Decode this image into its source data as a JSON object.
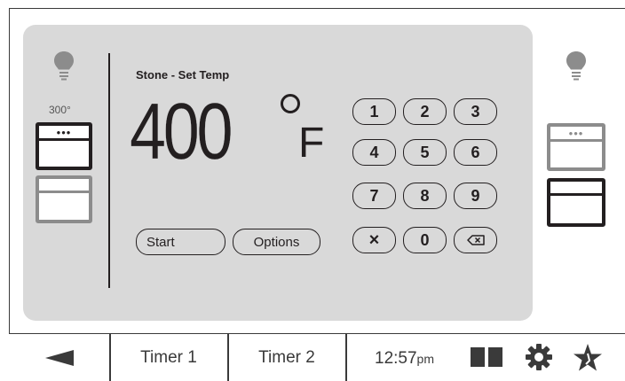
{
  "panel": {
    "title": "Stone - Set Temp",
    "temperature": "400",
    "unit": "F",
    "start_label": "Start",
    "options_label": "Options"
  },
  "left_oven": {
    "current_temp": "300°",
    "top_deck_selected": true
  },
  "right_oven": {
    "bottom_deck_selected": true
  },
  "keypad": {
    "keys": [
      "1",
      "2",
      "3",
      "4",
      "5",
      "6",
      "7",
      "8",
      "9",
      "×",
      "0",
      "backspace"
    ]
  },
  "bottom_bar": {
    "timer1": "Timer 1",
    "timer2": "Timer 2",
    "time": "12:57",
    "ampm": "pm"
  },
  "icons": {
    "back": "back-arrow-icon",
    "layout": "split-view-icon",
    "settings": "gear-icon",
    "favorite": "star-icon",
    "light": "light-bulb-icon",
    "backspace": "backspace-icon"
  },
  "colors": {
    "panel": "#d9d9d9",
    "ink": "#231f20",
    "inactive": "#8c8c8c"
  }
}
